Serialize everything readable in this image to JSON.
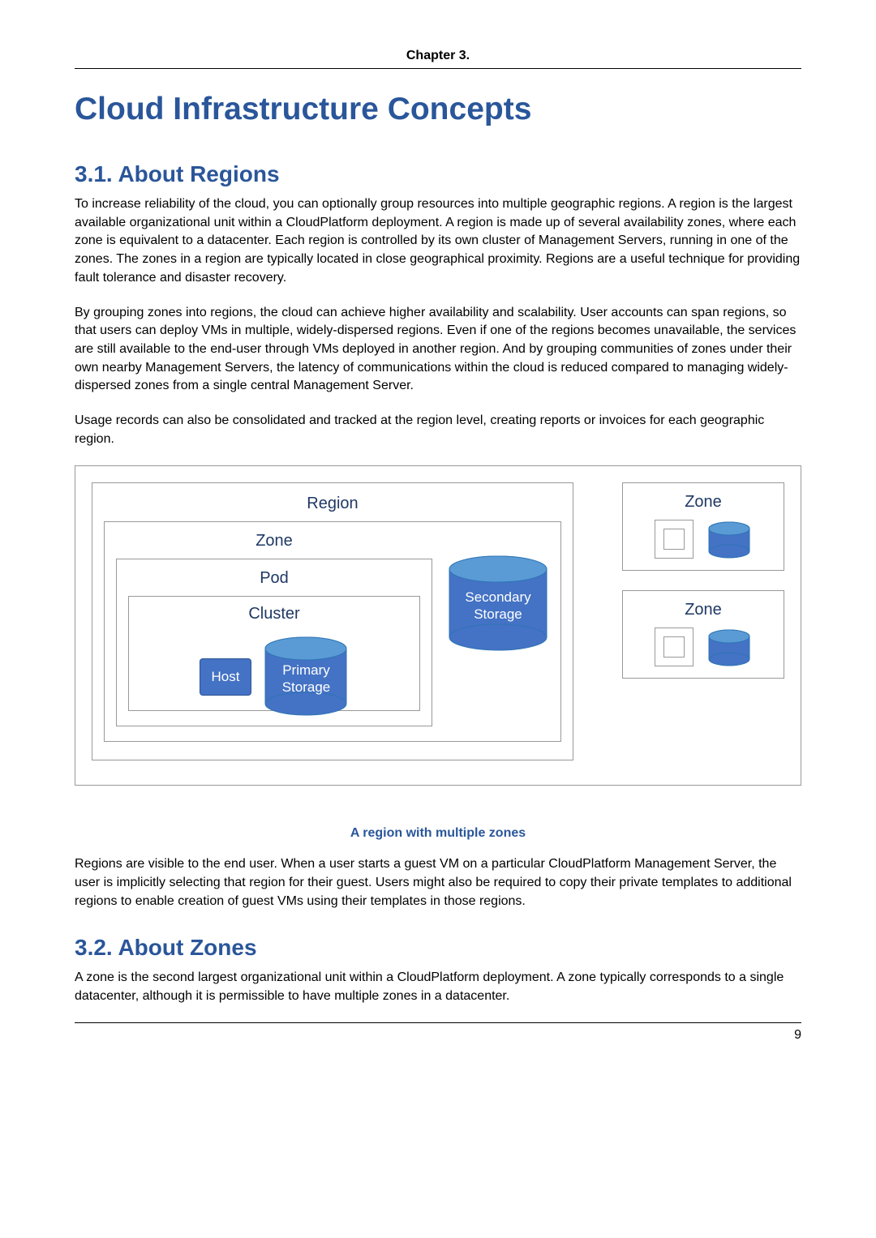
{
  "chapter": "Chapter 3.",
  "title": "Cloud Infrastructure Concepts",
  "section31": {
    "heading": "3.1. About Regions",
    "p1": "To increase reliability of the cloud, you can optionally group resources into multiple geographic regions. A region is the largest available organizational unit within a CloudPlatform deployment. A region is made up of several availability zones, where each zone is equivalent to a datacenter. Each region is controlled by its own cluster of Management Servers, running in one of the zones. The zones in a region are typically located in close geographical proximity. Regions are a useful technique for providing fault tolerance and disaster recovery.",
    "p2": "By grouping zones into regions, the cloud can achieve higher availability and scalability. User accounts can span regions, so that users can deploy VMs in multiple, widely-dispersed regions. Even if one of the regions becomes unavailable, the services are still available to the end-user through VMs deployed in another region. And by grouping communities of zones under their own nearby Management Servers, the latency of communications within the cloud is reduced compared to managing widely-dispersed zones from a single central Management Server.",
    "p3": "Usage records can also be consolidated and tracked at the region level, creating reports or invoices for each geographic region.",
    "p4": "Regions are visible to the end user. When a user starts a guest VM on a particular CloudPlatform Management Server, the user is implicitly selecting that region for their guest. Users might also be required to copy their private templates to additional regions to enable creation of guest VMs using their templates in those regions."
  },
  "diagram": {
    "region": "Region",
    "zone": "Zone",
    "pod": "Pod",
    "cluster": "Cluster",
    "host": "Host",
    "primary1": "Primary",
    "primary2": "Storage",
    "secondary1": "Secondary",
    "secondary2": "Storage",
    "caption": "A region with multiple zones"
  },
  "section32": {
    "heading": "3.2. About Zones",
    "p1": "A zone is the second largest organizational unit within a CloudPlatform deployment. A zone typically corresponds to a single datacenter, although it is permissible to have multiple zones in a datacenter."
  },
  "pageNumber": "9"
}
